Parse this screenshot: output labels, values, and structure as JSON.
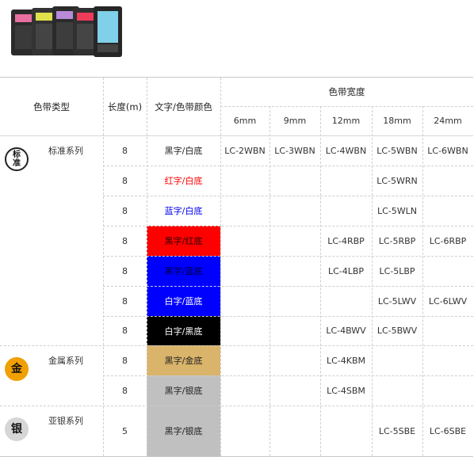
{
  "headers": {
    "type": "色带类型",
    "length": "长度(m)",
    "color": "文字/色带颜色",
    "width": "色带宽度",
    "widths": [
      "6mm",
      "9mm",
      "12mm",
      "18mm",
      "24mm"
    ]
  },
  "series": [
    {
      "badge": "标\n准",
      "name": "标准系列"
    },
    {
      "badge": "金",
      "name": "金属系列"
    },
    {
      "badge": "银",
      "name": "亚银系列"
    }
  ],
  "rows": [
    {
      "length": "8",
      "color_label": "黑字/白底",
      "text_color": "#222222",
      "bg": "#ffffff",
      "codes": [
        "LC-2WBN",
        "LC-3WBN",
        "LC-4WBN",
        "LC-5WBN",
        "LC-6WBN"
      ]
    },
    {
      "length": "8",
      "color_label": "红字/白底",
      "text_color": "#ff0000",
      "bg": "#ffffff",
      "codes": [
        "",
        "",
        "",
        "LC-5WRN",
        ""
      ]
    },
    {
      "length": "8",
      "color_label": "蓝字/白底",
      "text_color": "#0000ee",
      "bg": "#ffffff",
      "codes": [
        "",
        "",
        "",
        "LC-5WLN",
        ""
      ]
    },
    {
      "length": "8",
      "color_label": "黑字/红底",
      "text_color": "#2a0000",
      "bg": "#ff0000",
      "codes": [
        "",
        "",
        "LC-4RBP",
        "LC-5RBP",
        "LC-6RBP"
      ]
    },
    {
      "length": "8",
      "color_label": "黑字/蓝底",
      "text_color": "#00003a",
      "bg": "#0000ff",
      "codes": [
        "",
        "",
        "LC-4LBP",
        "LC-5LBP",
        ""
      ]
    },
    {
      "length": "8",
      "color_label": "白字/蓝底",
      "text_color": "#ffffff",
      "bg": "#0000ff",
      "codes": [
        "",
        "",
        "",
        "LC-5LWV",
        "LC-6LWV"
      ]
    },
    {
      "length": "8",
      "color_label": "白字/黑底",
      "text_color": "#ffffff",
      "bg": "#000000",
      "codes": [
        "",
        "",
        "LC-4BWV",
        "LC-5BWV",
        ""
      ]
    },
    {
      "length": "8",
      "color_label": "黑字/金底",
      "text_color": "#222222",
      "bg": "#d9b46a",
      "codes": [
        "",
        "",
        "LC-4KBM",
        "",
        ""
      ]
    },
    {
      "length": "8",
      "color_label": "黑字/银底",
      "text_color": "#222222",
      "bg": "#c0c0c0",
      "codes": [
        "",
        "",
        "LC-4SBM",
        "",
        ""
      ]
    },
    {
      "length": "5",
      "color_label": "黑字/银底",
      "text_color": "#222222",
      "bg": "#c0c0c0",
      "codes": [
        "",
        "",
        "",
        "LC-5SBE",
        "LC-6SBE"
      ]
    }
  ]
}
